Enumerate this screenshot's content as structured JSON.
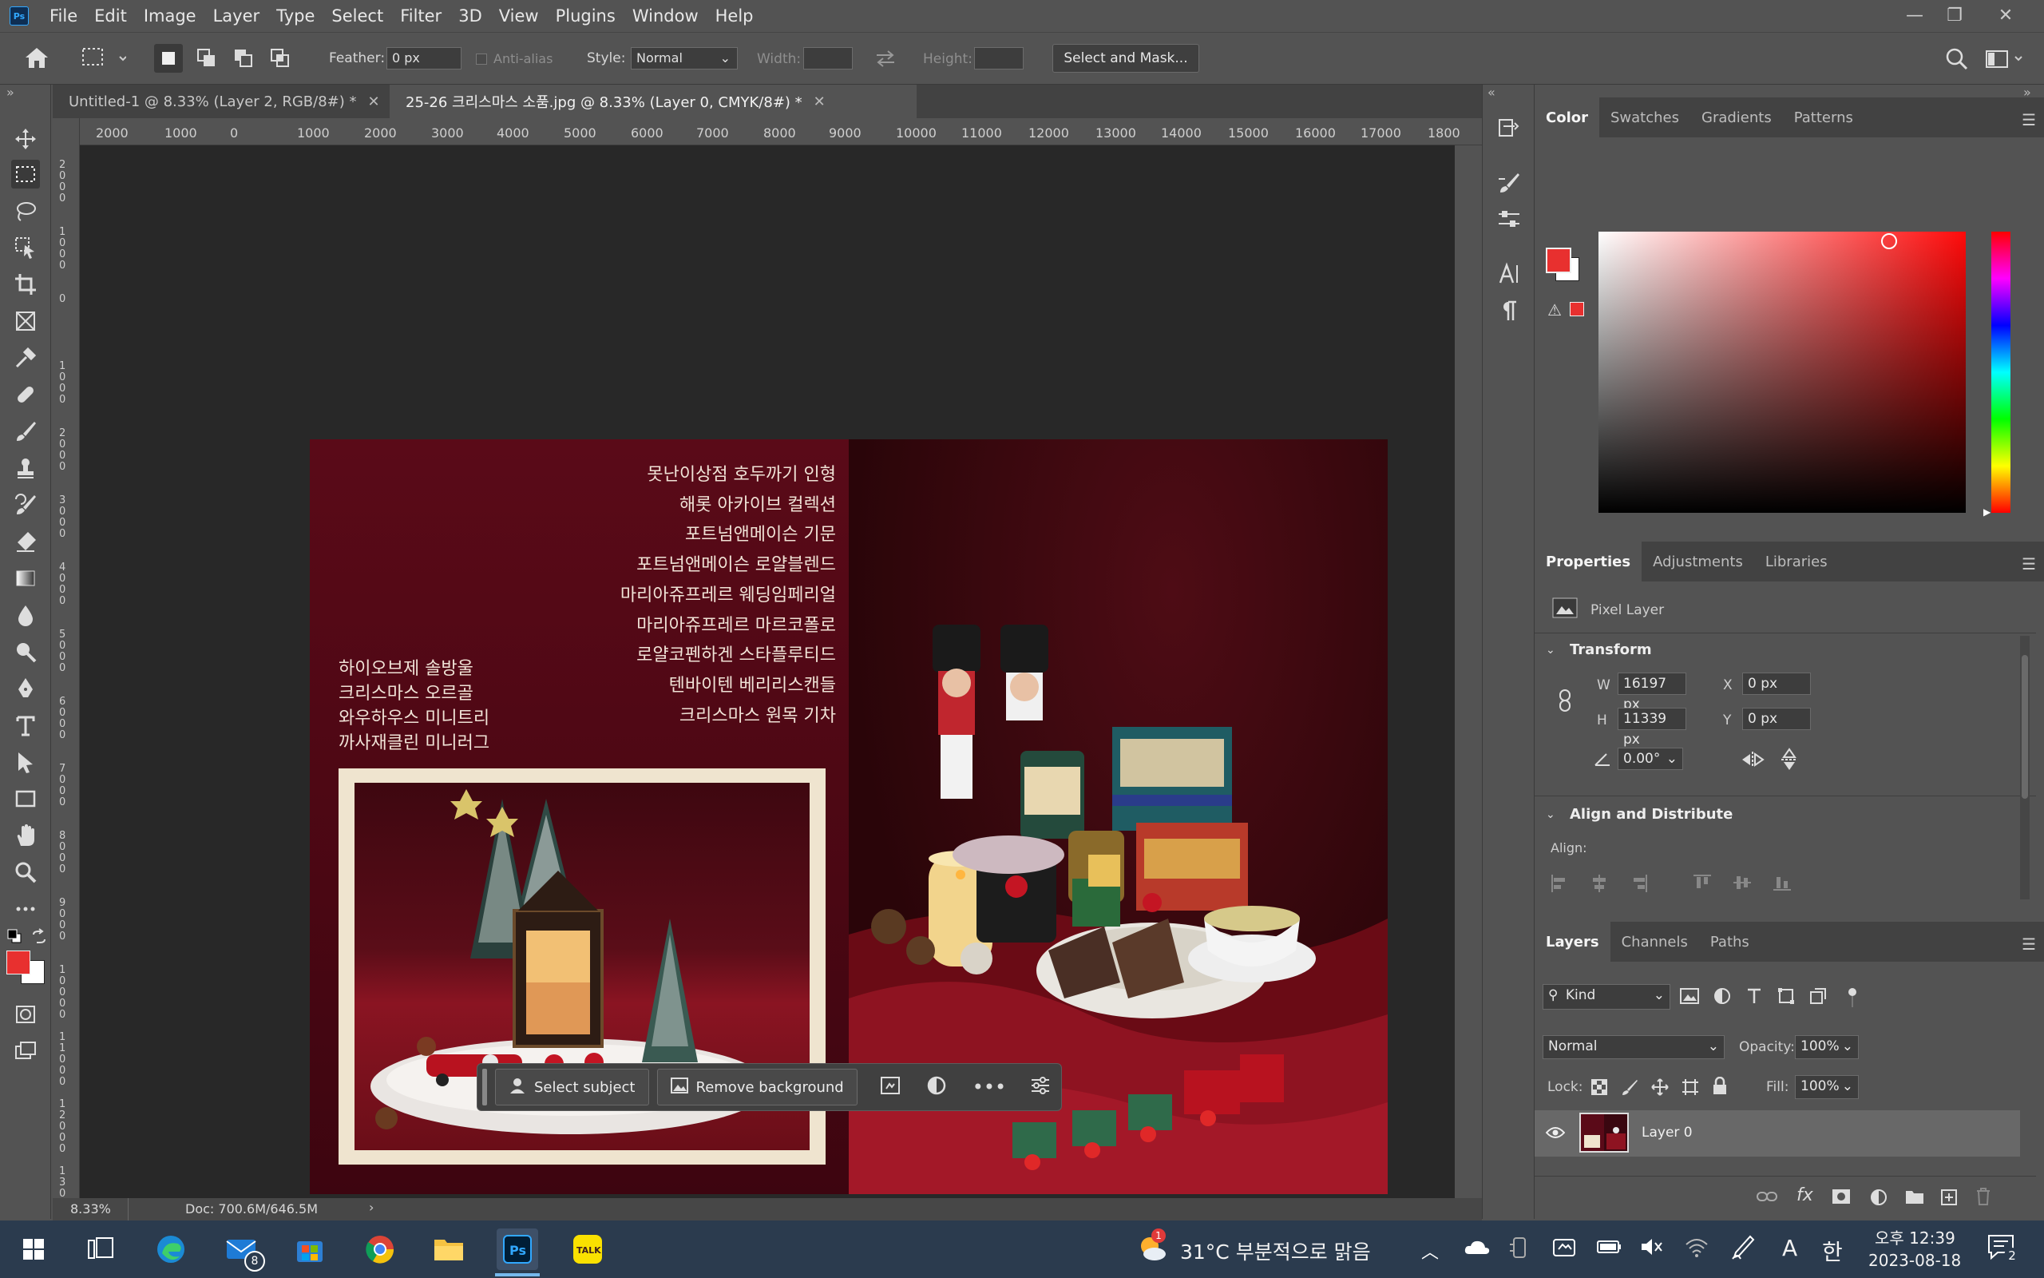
{
  "app": {
    "logo_text": "Ps",
    "menu": [
      "File",
      "Edit",
      "Image",
      "Layer",
      "Type",
      "Select",
      "Filter",
      "3D",
      "View",
      "Plugins",
      "Window",
      "Help"
    ]
  },
  "options": {
    "feather_label": "Feather:",
    "feather_value": "0 px",
    "antialias_label": "Anti-alias",
    "style_label": "Style:",
    "style_value": "Normal",
    "width_label": "Width:",
    "height_label": "Height:",
    "select_mask_label": "Select and Mask..."
  },
  "tabs": [
    {
      "label": "Untitled-1 @ 8.33% (Layer 2, RGB/8#) *",
      "active": false
    },
    {
      "label": "25-26 크리스마스 소품.jpg @ 8.33% (Layer 0, CMYK/8#) *",
      "active": true
    }
  ],
  "ruler": {
    "h_ticks": [
      "2000",
      "1000",
      "0",
      "1000",
      "2000",
      "3000",
      "4000",
      "5000",
      "6000",
      "7000",
      "8000",
      "9000",
      "10000",
      "11000",
      "12000",
      "13000",
      "14000",
      "15000",
      "16000",
      "17000",
      "1800"
    ],
    "v_ticks": [
      "2 0 0 0",
      "1 0 0 0",
      "0",
      "1 0 0 0",
      "2 0 0 0",
      "3 0 0 0",
      "4 0 0 0",
      "5 0 0 0",
      "6 0 0 0",
      "7 0 0 0",
      "8 0 0 0",
      "9 0 0 0",
      "1 0 0 0 0",
      "1 1 0 0 0",
      "1 2 0 0 0",
      "1 3 0 0 0"
    ]
  },
  "document": {
    "right_list": [
      "못난이상점 호두까기 인형",
      "해롯 아카이브 컬렉션",
      "포트넘앤메이슨 기문",
      "포트넘앤메이슨 로얄블렌드",
      "마리아쥬프레르 웨딩임페리얼",
      "마리아쥬프레르 마르코폴로",
      "로얄코펜하겐 스타플루티드",
      "텐바이텐 베리리스캔들",
      "크리스마스 원목 기차"
    ],
    "left_list": [
      "하이오브제 솔방울",
      "크리스마스 오르골",
      "와우하우스 미니트리",
      "까사재클린 미니러그"
    ]
  },
  "context_bar": {
    "select_subject": "Select subject",
    "remove_background": "Remove background"
  },
  "status": {
    "zoom": "8.33%",
    "doc": "Doc: 700.6M/646.5M"
  },
  "color_panel": {
    "tabs": [
      "Color",
      "Swatches",
      "Gradients",
      "Patterns"
    ],
    "foreground": "#e8302f",
    "background": "#ffffff"
  },
  "properties_panel": {
    "tabs": [
      "Properties",
      "Adjustments",
      "Libraries"
    ],
    "layer_type": "Pixel Layer",
    "transform_title": "Transform",
    "w_label": "W",
    "w_value": "16197 px",
    "h_label": "H",
    "h_value": "11339 px",
    "x_label": "X",
    "x_value": "0 px",
    "y_label": "Y",
    "y_value": "0 px",
    "angle_value": "0.00°",
    "align_title": "Align and Distribute",
    "align_label": "Align:"
  },
  "layers_panel": {
    "tabs": [
      "Layers",
      "Channels",
      "Paths"
    ],
    "filter_kind": "Kind",
    "blend_mode": "Normal",
    "opacity_label": "Opacity:",
    "opacity_value": "100%",
    "lock_label": "Lock:",
    "fill_label": "Fill:",
    "fill_value": "100%",
    "layers": [
      {
        "name": "Layer 0",
        "visible": true
      }
    ]
  },
  "taskbar": {
    "mail_badge": "8",
    "weather_badge": "1",
    "weather": "31°C  부분적으로 맑음",
    "ime_a": "A",
    "ime_han": "한",
    "time": "오후 12:39",
    "date": "2023-08-18",
    "notif_count": "2"
  }
}
